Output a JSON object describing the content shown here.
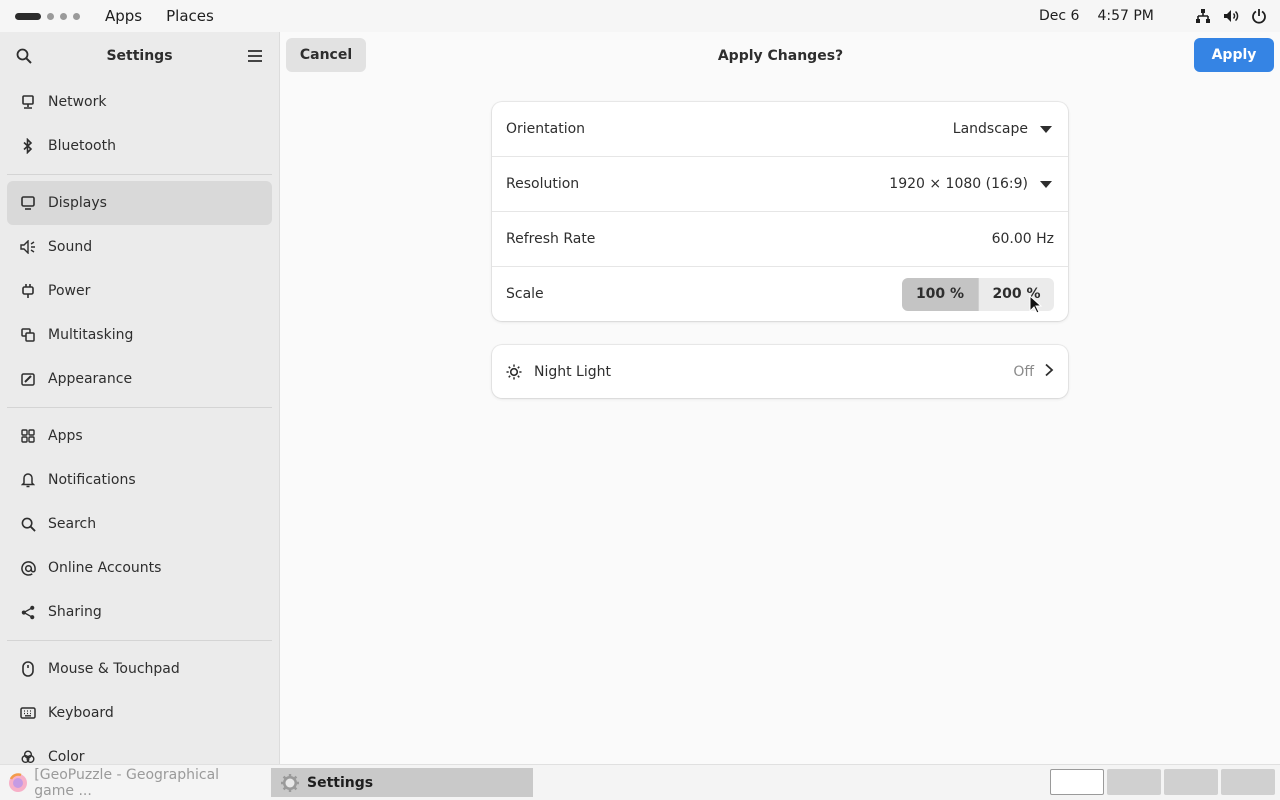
{
  "topbar": {
    "apps_label": "Apps",
    "places_label": "Places",
    "date": "Dec 6",
    "time": "4:57 PM",
    "tray_icons": [
      "network-icon",
      "volume-icon",
      "power-icon"
    ]
  },
  "sidebar": {
    "title": "Settings",
    "items": [
      {
        "label": "Network",
        "icon": "network-icon"
      },
      {
        "label": "Bluetooth",
        "icon": "bluetooth-icon"
      },
      {
        "label": "Displays",
        "icon": "display-icon",
        "active": true
      },
      {
        "label": "Sound",
        "icon": "sound-icon"
      },
      {
        "label": "Power",
        "icon": "power-plug-icon"
      },
      {
        "label": "Multitasking",
        "icon": "multitasking-icon"
      },
      {
        "label": "Appearance",
        "icon": "appearance-icon"
      },
      {
        "label": "Apps",
        "icon": "apps-grid-icon"
      },
      {
        "label": "Notifications",
        "icon": "bell-icon"
      },
      {
        "label": "Search",
        "icon": "search-icon"
      },
      {
        "label": "Online Accounts",
        "icon": "at-icon"
      },
      {
        "label": "Sharing",
        "icon": "share-icon"
      },
      {
        "label": "Mouse & Touchpad",
        "icon": "mouse-icon"
      },
      {
        "label": "Keyboard",
        "icon": "keyboard-icon"
      },
      {
        "label": "Color",
        "icon": "color-icon"
      }
    ]
  },
  "header": {
    "cancel_label": "Cancel",
    "title": "Apply Changes?",
    "apply_label": "Apply"
  },
  "display": {
    "orientation": {
      "label": "Orientation",
      "value": "Landscape"
    },
    "resolution": {
      "label": "Resolution",
      "value": "1920 × 1080 (16:9)"
    },
    "refresh_rate": {
      "label": "Refresh Rate",
      "value": "60.00 Hz"
    },
    "scale": {
      "label": "Scale",
      "options": [
        "100 %",
        "200 %"
      ],
      "selected": "100 %"
    }
  },
  "night_light": {
    "label": "Night Light",
    "status": "Off"
  },
  "taskbar": {
    "tasks": [
      {
        "label": "[GeoPuzzle - Geographical game ...",
        "active": false
      },
      {
        "label": "Settings",
        "active": true
      }
    ],
    "workspace_count": 4,
    "current_workspace": 1
  },
  "colors": {
    "accent": "#3584e4",
    "sidebar_bg": "#ebebeb",
    "content_bg": "#fafafa"
  }
}
